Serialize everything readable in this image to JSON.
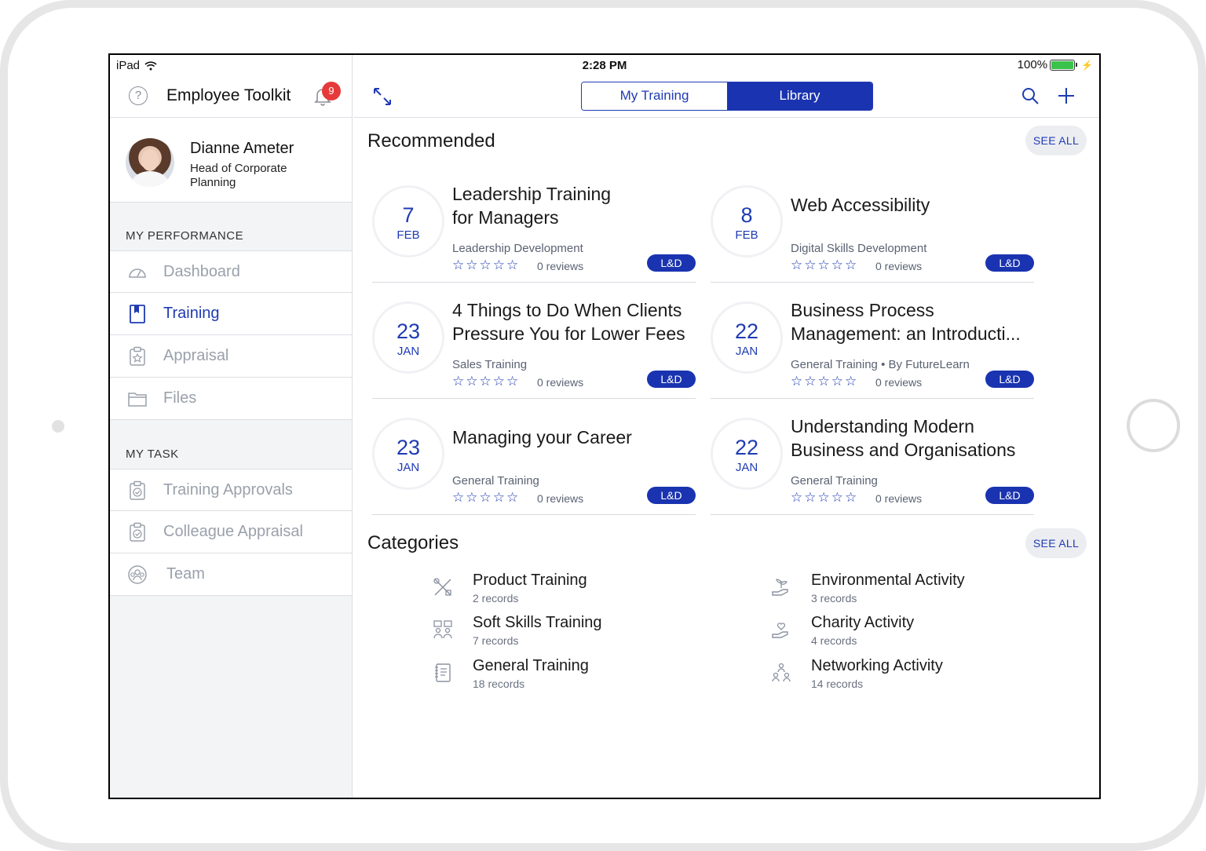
{
  "status_bar": {
    "device": "iPad",
    "time": "2:28 PM",
    "battery": "100%"
  },
  "sidebar": {
    "app_title": "Employee Toolkit",
    "notification_count": "9",
    "help_glyph": "?",
    "profile": {
      "name": "Dianne Ameter",
      "role": "Head of Corporate Planning"
    },
    "sections": {
      "performance": {
        "label": "MY PERFORMANCE",
        "items": [
          {
            "label": "Dashboard",
            "icon": "gauge-icon"
          },
          {
            "label": "Training",
            "icon": "book-icon",
            "active": true
          },
          {
            "label": "Appraisal",
            "icon": "clipboard-star-icon"
          },
          {
            "label": "Files",
            "icon": "folder-icon"
          }
        ]
      },
      "task": {
        "label": "MY TASK",
        "items": [
          {
            "label": "Training Approvals",
            "icon": "clipboard-check-icon"
          },
          {
            "label": "Colleague Appraisal",
            "icon": "clipboard-check-icon"
          },
          {
            "label": "Team",
            "icon": "team-icon"
          }
        ]
      }
    }
  },
  "header": {
    "tabs": [
      {
        "label": "My Training",
        "selected": false
      },
      {
        "label": "Library",
        "selected": true
      }
    ]
  },
  "recommended": {
    "title": "Recommended",
    "see_all": "SEE ALL",
    "cards": [
      {
        "day": "7",
        "month": "FEB",
        "title": "Leadership Training for Managers",
        "subtitle": "Leadership Development",
        "stars": "☆☆☆☆☆",
        "reviews": "0 reviews",
        "tag": "L&D"
      },
      {
        "day": "8",
        "month": "FEB",
        "title": "Web Accessibility",
        "subtitle": "Digital Skills Development",
        "stars": "☆☆☆☆☆",
        "reviews": "0 reviews",
        "tag": "L&D"
      },
      {
        "day": "23",
        "month": "JAN",
        "title": "4 Things to Do When Clients Pressure You for Lower Fees",
        "subtitle": "Sales Training",
        "stars": "☆☆☆☆☆",
        "reviews": "0 reviews",
        "tag": "L&D"
      },
      {
        "day": "22",
        "month": "JAN",
        "title": "Business Process Management: an Introducti...",
        "subtitle": "General Training • By FutureLearn",
        "stars": "☆☆☆☆☆",
        "reviews": "0 reviews",
        "tag": "L&D"
      },
      {
        "day": "23",
        "month": "JAN",
        "title": "Managing your Career",
        "subtitle": "General Training",
        "stars": "☆☆☆☆☆",
        "reviews": "0 reviews",
        "tag": "L&D"
      },
      {
        "day": "22",
        "month": "JAN",
        "title": "Understanding Modern Business and Organisations",
        "subtitle": "General Training",
        "stars": "☆☆☆☆☆",
        "reviews": "0 reviews",
        "tag": "L&D"
      }
    ]
  },
  "categories": {
    "title": "Categories",
    "see_all": "SEE ALL",
    "items": [
      {
        "name": "Product Training",
        "count": "2 records",
        "icon": "tools-icon"
      },
      {
        "name": "Environmental Activity",
        "count": "3 records",
        "icon": "plant-hand-icon"
      },
      {
        "name": "Soft Skills Training",
        "count": "7 records",
        "icon": "people-chat-icon"
      },
      {
        "name": "Charity Activity",
        "count": "4 records",
        "icon": "giving-hand-icon"
      },
      {
        "name": "General Training",
        "count": "18 records",
        "icon": "notebook-icon"
      },
      {
        "name": "Networking Activity",
        "count": "14 records",
        "icon": "network-people-icon"
      }
    ]
  },
  "colors": {
    "accent": "#1a33b0",
    "badge": "#e63a3a",
    "muted": "#9aa1ab"
  }
}
